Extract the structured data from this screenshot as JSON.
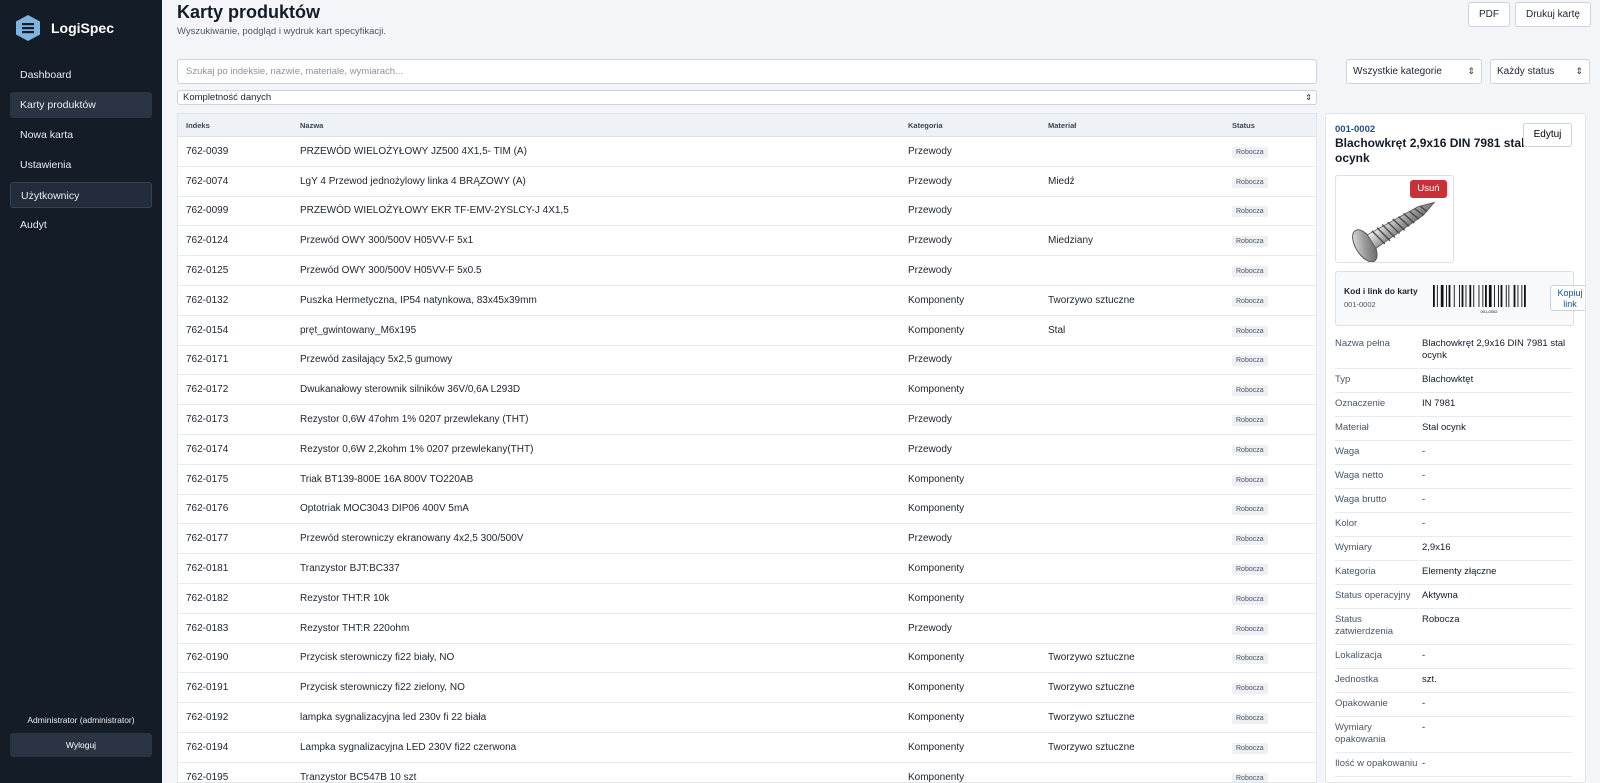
{
  "app": {
    "name": "LogiSpec"
  },
  "sidebar": {
    "items": [
      {
        "label": "Dashboard"
      },
      {
        "label": "Karty produktów"
      },
      {
        "label": "Nowa karta"
      },
      {
        "label": "Ustawienia"
      },
      {
        "label": "Użytkownicy"
      },
      {
        "label": "Audyt"
      }
    ],
    "user": "Administrator (administrator)",
    "logout": "Wyloguj"
  },
  "header": {
    "title": "Karty produktów",
    "subtitle": "Wyszukiwanie, podgląd i wydruk kart specyfikacji.",
    "pdf_label": "PDF",
    "print_label": "Drukuj kartę"
  },
  "filters": {
    "search_placeholder": "Szukaj po indeksie, nazwie, materiale, wymiarach...",
    "category": "Wszystkie kategorie",
    "status": "Każdy status",
    "completeness": "Kompletność danych"
  },
  "table": {
    "headers": [
      "Indeks",
      "Nazwa",
      "Kategoria",
      "Materiał",
      "Status"
    ],
    "rows": [
      [
        "762-0039",
        "PRZEWÓD WIELOŻYŁOWY JZ500 4X1,5- TIM (A)",
        "Przewody",
        "",
        "Robocza"
      ],
      [
        "762-0074",
        "LgY 4 Przewod jednożylowy linka 4 BRĄZOWY (A)",
        "Przewody",
        "Miedź",
        "Robocza"
      ],
      [
        "762-0099",
        "PRZEWÓD WIELOŻYŁOWY EKR TF-EMV-2YSLCY-J 4X1,5",
        "Przewody",
        "",
        "Robocza"
      ],
      [
        "762-0124",
        "Przewód OWY 300/500V H05VV-F 5x1",
        "Przewody",
        "Miedziany",
        "Robocza"
      ],
      [
        "762-0125",
        "Przewód OWY 300/500V H05VV-F 5x0.5",
        "Przewody",
        "",
        "Robocza"
      ],
      [
        "762-0132",
        "Puszka Hermetyczna, IP54 natynkowa, 83x45x39mm",
        "Komponenty",
        "Tworzywo sztuczne",
        "Robocza"
      ],
      [
        "762-0154",
        "pręt_gwintowany_M6x195",
        "Komponenty",
        "Stal",
        "Robocza"
      ],
      [
        "762-0171",
        "Przewód zasilający 5x2,5 gumowy",
        "Przewody",
        "",
        "Robocza"
      ],
      [
        "762-0172",
        "Dwukanałowy sterownik silników 36V/0,6A L293D",
        "Komponenty",
        "",
        "Robocza"
      ],
      [
        "762-0173",
        "Rezystor 0,6W 47ohm 1% 0207 przewlekany (THT)",
        "Przewody",
        "",
        "Robocza"
      ],
      [
        "762-0174",
        "Rezystor 0,6W 2,2kohm 1% 0207 przewlekany(THT)",
        "Przewody",
        "",
        "Robocza"
      ],
      [
        "762-0175",
        "Triak BT139-800E 16A 800V TO220AB",
        "Komponenty",
        "",
        "Robocza"
      ],
      [
        "762-0176",
        "Optotriak MOC3043 DIP06 400V 5mA",
        "Komponenty",
        "",
        "Robocza"
      ],
      [
        "762-0177",
        "Przewód sterowniczy ekranowany 4x2,5 300/500V",
        "Przewody",
        "",
        "Robocza"
      ],
      [
        "762-0181",
        "Tranzystor BJT:BC337",
        "Komponenty",
        "",
        "Robocza"
      ],
      [
        "762-0182",
        "Rezystor THT:R 10k",
        "Komponenty",
        "",
        "Robocza"
      ],
      [
        "762-0183",
        "Rezystor THT:R 220ohm",
        "Przewody",
        "",
        "Robocza"
      ],
      [
        "762-0190",
        "Przycisk sterowniczy fi22 biały, NO",
        "Komponenty",
        "Tworzywo sztuczne",
        "Robocza"
      ],
      [
        "762-0191",
        "Przycisk sterowniczy fi22 zielony, NO",
        "Komponenty",
        "Tworzywo sztuczne",
        "Robocza"
      ],
      [
        "762-0192",
        "lampka sygnalizacyjna led 230v fi 22 biała",
        "Komponenty",
        "Tworzywo sztuczne",
        "Robocza"
      ],
      [
        "762-0194",
        "Lampka sygnalizacyjna LED 230V fi22 czerwona",
        "Komponenty",
        "Tworzywo sztuczne",
        "Robocza"
      ],
      [
        "762-0195",
        "Tranzystor BC547B 10 szt",
        "Komponenty",
        "",
        "Robocza"
      ]
    ]
  },
  "detail": {
    "index": "001-0002",
    "title": "Blachowkręt 2,9x16 DIN 7981 stal ocynk",
    "edit_label": "Edytuj",
    "delete_label": "Usuń",
    "qr_title": "Kod i link do karty",
    "qr_code": "001-0002",
    "barcode_text": "001-0002",
    "copy_label": "Kopiuj link",
    "props": [
      [
        "Nazwa pełna",
        "Blachowkręt 2,9x16 DIN 7981 stal ocynk"
      ],
      [
        "Typ",
        "Blachowktęt"
      ],
      [
        "Oznaczenie",
        "IN 7981"
      ],
      [
        "Materiał",
        "Stal ocynk"
      ],
      [
        "Waga",
        "-"
      ],
      [
        "Waga netto",
        "-"
      ],
      [
        "Waga brutto",
        "-"
      ],
      [
        "Kolor",
        "-"
      ],
      [
        "Wymiary",
        "2,9x16"
      ],
      [
        "Kategoria",
        "Elementy złączne"
      ],
      [
        "Status operacyjny",
        "Aktywna"
      ],
      [
        "Status zatwierdzenia",
        "Robocza"
      ],
      [
        "Lokalizacja",
        "-"
      ],
      [
        "Jednostka",
        "szt."
      ],
      [
        "Opakowanie",
        "-"
      ],
      [
        "Wymiary opakowania",
        "-"
      ],
      [
        "Ilość w opakowaniu",
        "-"
      ]
    ]
  }
}
